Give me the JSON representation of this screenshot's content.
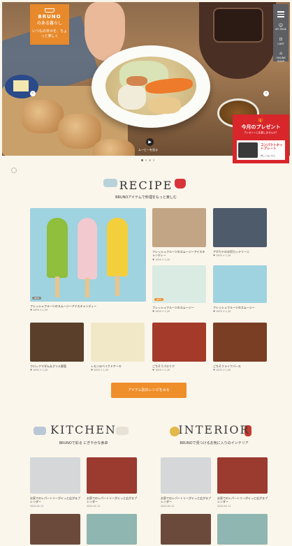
{
  "brand": {
    "logo_text": "BRUNO",
    "logo_sub": "のある暮らし",
    "logo_tagline": "いつもの日々を、ちょっと楽しく"
  },
  "menu": {
    "items": [
      "MY PAGE",
      "CART",
      "ONLINE SHOP"
    ]
  },
  "hero": {
    "play_label": "ムービーを見る"
  },
  "promo": {
    "title": "今月のプレゼント",
    "subtitle": "プレゼントに応募しませんか？",
    "product": "コンパクトホットプレート",
    "cta": "詳しくはこちら"
  },
  "recipe": {
    "title": "RECIPE",
    "subtitle": "BRUNOアイテムで料理をもっと楽しむ",
    "featured": {
      "caption": "フレッシュフルーツのスムージーアイスキャンディー",
      "meta": "♥ 1000  ⊙ 1,20",
      "tag": "NEW"
    },
    "items": [
      {
        "caption": "フレッシュフルーツのスムージーアイスキャンディー",
        "meta": "♥ 1000  ⊙ 1,20"
      },
      {
        "caption": "アボカドの水切カッテリーニ",
        "meta": "♥ 1000  ⊙ 1,20"
      },
      {
        "caption": "フレッシュフルーツのスムージー",
        "meta": "♥ 1000  ⊙ 1,20"
      },
      {
        "caption": "フレッシュフルーツのスムージー",
        "meta": "♥ 1000  ⊙ 1,20"
      },
      {
        "caption": "クロックマダム＆グリル野菜",
        "meta": "♥ 1000  ⊙ 1,20"
      },
      {
        "caption": "レモンのベイクドケーキ",
        "meta": "♥ 1000  ⊙ 1,20"
      },
      {
        "caption": "ごちそうパエリア",
        "meta": "♥ 1000  ⊙ 1,20"
      },
      {
        "caption": "ごちそうライフパース",
        "meta": "♥ 1000  ⊙ 1,20"
      }
    ],
    "button": "アイテム別のレシピをみる"
  },
  "kitchen": {
    "title": "KITCHEN",
    "subtitle": "BRUNOで彩る にぎやかな食卓",
    "items": [
      {
        "caption": "お家でのレパートリーがぐっと広がるプレンダー",
        "meta": "2020.01.11"
      },
      {
        "caption": "お家でのレパートリーがぐっと広がるプレンダー",
        "meta": "2020.01.11"
      }
    ]
  },
  "interior": {
    "title": "INTERIOR",
    "subtitle": "BRUNOで見つけるお気に入りのインテリア",
    "items": [
      {
        "caption": "お家でのレパートリーがぐっと広がるプレンダー",
        "meta": "2020.01.11"
      },
      {
        "caption": "お家でのレパートリーがぐっと広がるプレンダー",
        "meta": "2020.01.11"
      }
    ]
  },
  "colors": {
    "accent": "#ef8f2b",
    "promo": "#d8262b",
    "background": "#fbf6ec"
  }
}
